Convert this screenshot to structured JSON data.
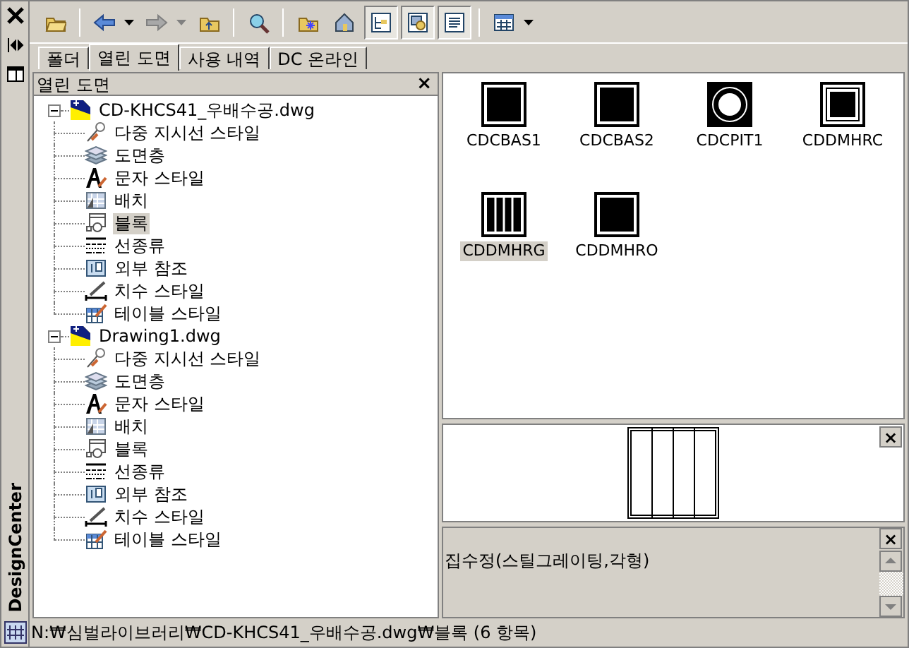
{
  "side_strip": {
    "title": "DesignCenter"
  },
  "toolbar": [
    {
      "kind": "load",
      "on": false
    },
    {
      "kind": "back",
      "on": false
    },
    {
      "kind": "forward",
      "on": false
    },
    {
      "kind": "up",
      "on": false
    },
    {
      "kind": "search",
      "on": false
    },
    {
      "kind": "favorites",
      "on": false
    },
    {
      "kind": "home",
      "on": false
    },
    {
      "kind": "tree",
      "on": true
    },
    {
      "kind": "preview",
      "on": true
    },
    {
      "kind": "description",
      "on": true
    },
    {
      "kind": "views",
      "on": false
    }
  ],
  "tabs": [
    {
      "label": "폴더",
      "selected": false
    },
    {
      "label": "열린 도면",
      "selected": true
    },
    {
      "label": "사용 내역",
      "selected": false
    },
    {
      "label": "DC 온라인",
      "selected": false
    }
  ],
  "tree": {
    "title": "열린 도면",
    "close": "×",
    "items": [
      {
        "label": "CD-KHCS41_우배수공.dwg",
        "expanded": true,
        "children": [
          {
            "label": "다중 지시선 스타일",
            "kind": "mleader",
            "selected": false
          },
          {
            "label": "도면층",
            "kind": "layer",
            "selected": false
          },
          {
            "label": "문자 스타일",
            "kind": "text",
            "selected": false
          },
          {
            "label": "배치",
            "kind": "layout",
            "selected": false
          },
          {
            "label": "블록",
            "kind": "block",
            "selected": true
          },
          {
            "label": "선종류",
            "kind": "linetype",
            "selected": false
          },
          {
            "label": "외부 참조",
            "kind": "xref",
            "selected": false
          },
          {
            "label": "치수 스타일",
            "kind": "dim",
            "selected": false
          },
          {
            "label": "테이블 스타일",
            "kind": "table",
            "selected": false
          }
        ]
      },
      {
        "label": "Drawing1.dwg",
        "expanded": true,
        "children": [
          {
            "label": "다중 지시선 스타일",
            "kind": "mleader",
            "selected": false
          },
          {
            "label": "도면층",
            "kind": "layer",
            "selected": false
          },
          {
            "label": "문자 스타일",
            "kind": "text",
            "selected": false
          },
          {
            "label": "배치",
            "kind": "layout",
            "selected": false
          },
          {
            "label": "블록",
            "kind": "block",
            "selected": false
          },
          {
            "label": "선종류",
            "kind": "linetype",
            "selected": false
          },
          {
            "label": "외부 참조",
            "kind": "xref",
            "selected": false
          },
          {
            "label": "치수 스타일",
            "kind": "dim",
            "selected": false
          },
          {
            "label": "테이블 스타일",
            "kind": "table",
            "selected": false
          }
        ]
      }
    ]
  },
  "blocks": [
    {
      "name": "CDCBAS1",
      "kind": "square",
      "selected": false
    },
    {
      "name": "CDCBAS2",
      "kind": "square",
      "selected": false
    },
    {
      "name": "CDCPIT1",
      "kind": "pit",
      "selected": false
    },
    {
      "name": "CDDMHRC",
      "kind": "double",
      "selected": false
    },
    {
      "name": "CDDMHRG",
      "kind": "grate",
      "selected": true
    },
    {
      "name": "CDDMHRO",
      "kind": "square",
      "selected": false
    }
  ],
  "preview": {
    "close": "×"
  },
  "description": {
    "close": "×",
    "text": "집수정(스틸그레이팅,각형)"
  },
  "status_bar": {
    "path": "N:₩심벌라이브러리₩CD-KHCS41_우배수공.dwg₩블록 (6 항목)"
  }
}
